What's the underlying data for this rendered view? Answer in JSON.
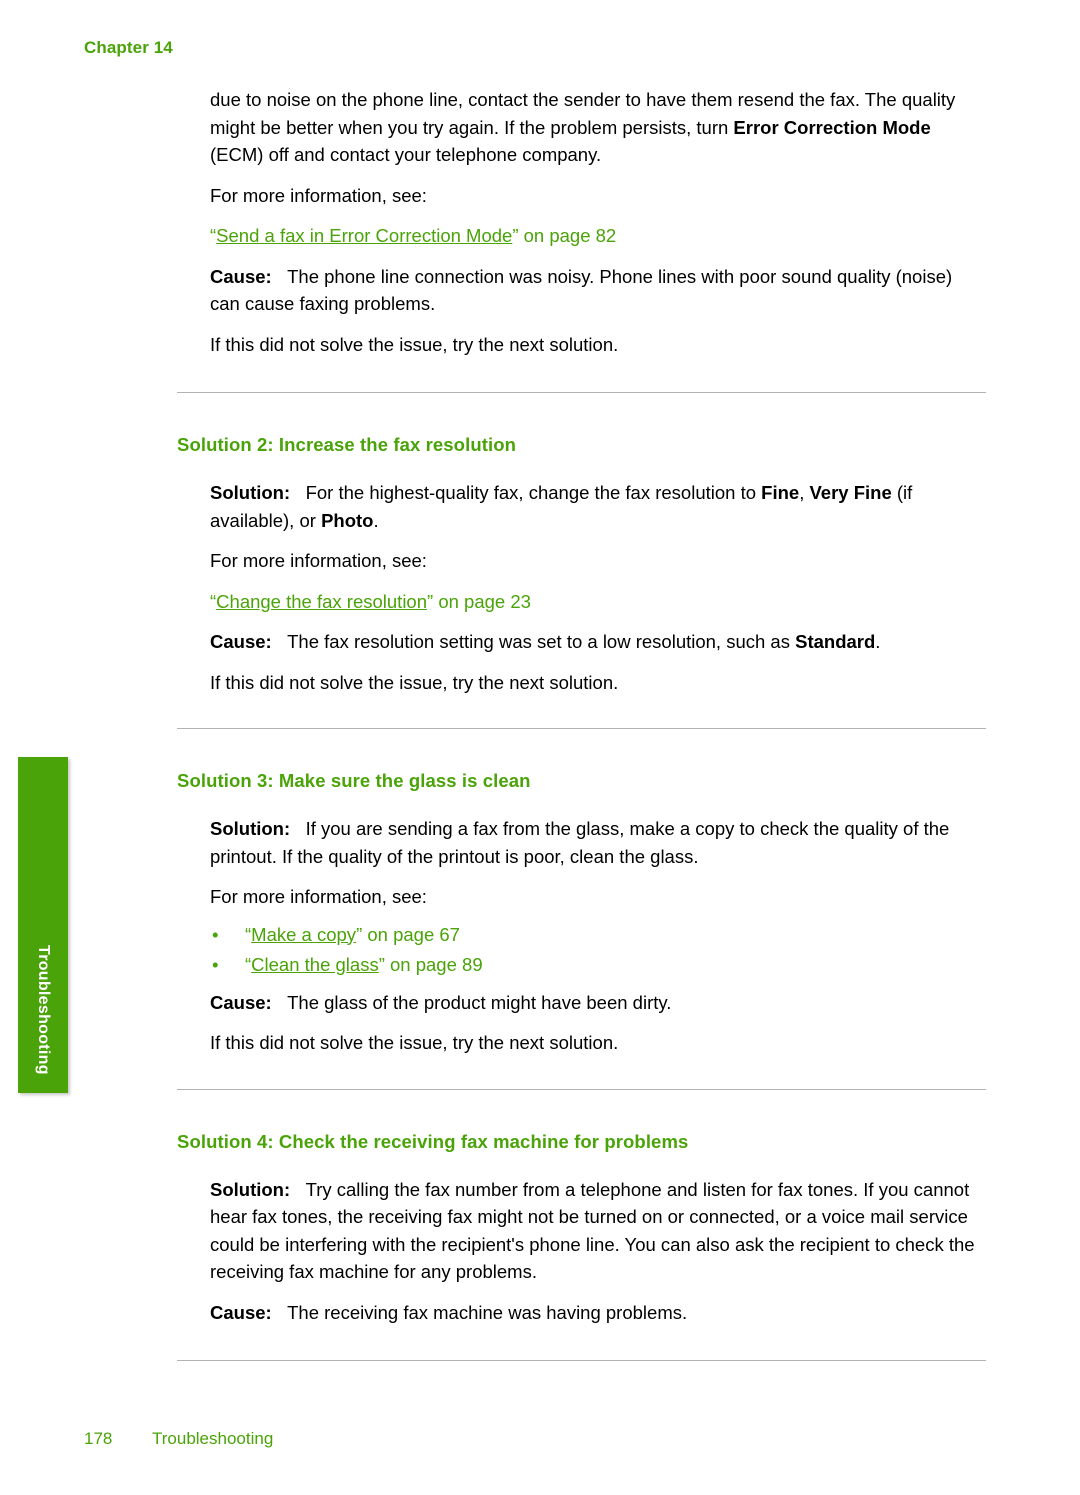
{
  "header": {
    "chapter_label": "Chapter 14"
  },
  "side_tab": {
    "label": "Troubleshooting",
    "color": "#4aa308"
  },
  "footer": {
    "page_number": "178",
    "section_label": "Troubleshooting"
  },
  "colors": {
    "accent_green": "#4aa308",
    "rule_gray": "#b3b3b3",
    "body_black": "#000000"
  },
  "content": {
    "intro": {
      "line1_a": "due to noise on the phone line, contact the sender to have them resend the fax. The quality might be better when you try again. If the problem persists, turn ",
      "line1_b": "Error Correction Mode",
      "line1_c": " (ECM) off and contact your telephone company.",
      "more_info": "For more information, see:",
      "xref_quote_open": "“",
      "xref_link": "Send a fax in Error Correction Mode",
      "xref_quote_close": "”",
      "xref_page": " on page 82",
      "cause_label": "Cause:",
      "cause_text": "The phone line connection was noisy. Phone lines with poor sound quality (noise) can cause faxing problems.",
      "next_solution": "If this did not solve the issue, try the next solution."
    },
    "solution2": {
      "heading": "Solution 2: Increase the fax resolution",
      "solution_label": "Solution:",
      "solution_a": "For the highest-quality fax, change the fax resolution to ",
      "solution_b1": "Fine",
      "solution_mid1": ", ",
      "solution_b2": "Very Fine",
      "solution_mid2": " (if available), or ",
      "solution_b3": "Photo",
      "solution_end": ".",
      "more_info": "For more information, see:",
      "xref_quote_open": "“",
      "xref_link": "Change the fax resolution",
      "xref_quote_close": "”",
      "xref_page": " on page 23",
      "cause_label": "Cause:",
      "cause_a": "The fax resolution setting was set to a low resolution, such as ",
      "cause_b": "Standard",
      "cause_end": ".",
      "next_solution": "If this did not solve the issue, try the next solution."
    },
    "solution3": {
      "heading": "Solution 3: Make sure the glass is clean",
      "solution_label": "Solution:",
      "solution_text": "If you are sending a fax from the glass, make a copy to check the quality of the printout. If the quality of the printout is poor, clean the glass.",
      "more_info": "For more information, see:",
      "bullets": [
        {
          "bullet": "•",
          "quote_open": "“",
          "link": "Make a copy",
          "quote_close": "”",
          "page": " on page 67"
        },
        {
          "bullet": "•",
          "quote_open": "“",
          "link": "Clean the glass",
          "quote_close": "”",
          "page": " on page 89"
        }
      ],
      "cause_label": "Cause:",
      "cause_text": "The glass of the product might have been dirty.",
      "next_solution": "If this did not solve the issue, try the next solution."
    },
    "solution4": {
      "heading": "Solution 4: Check the receiving fax machine for problems",
      "solution_label": "Solution:",
      "solution_text": "Try calling the fax number from a telephone and listen for fax tones. If you cannot hear fax tones, the receiving fax might not be turned on or connected, or a voice mail service could be interfering with the recipient's phone line. You can also ask the recipient to check the receiving fax machine for any problems.",
      "cause_label": "Cause:",
      "cause_text": "The receiving fax machine was having problems."
    }
  }
}
